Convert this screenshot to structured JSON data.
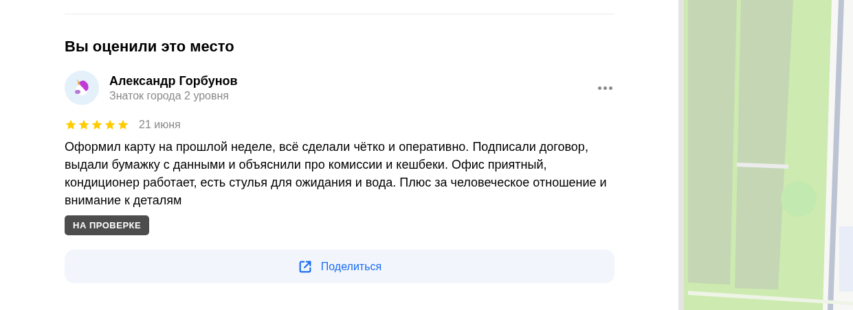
{
  "section": {
    "title": "Вы оценили это место"
  },
  "review": {
    "author": "Александр Горбунов",
    "author_level": "Знаток города 2 уровня",
    "stars": 5,
    "date": "21 июня",
    "text": "Оформил карту на прошлой неделе, всё сделали чётко и оперативно. Подписали договор, выдали бумажку с данными и объяснили про комиссии и кешбеки. Офис приятный, кондиционер работает, есть стулья для ожидания и вода. Плюс за человеческое отношение и внимание к деталям",
    "status": "НА ПРОВЕРКЕ"
  },
  "share_button": {
    "label": "Поделиться"
  }
}
